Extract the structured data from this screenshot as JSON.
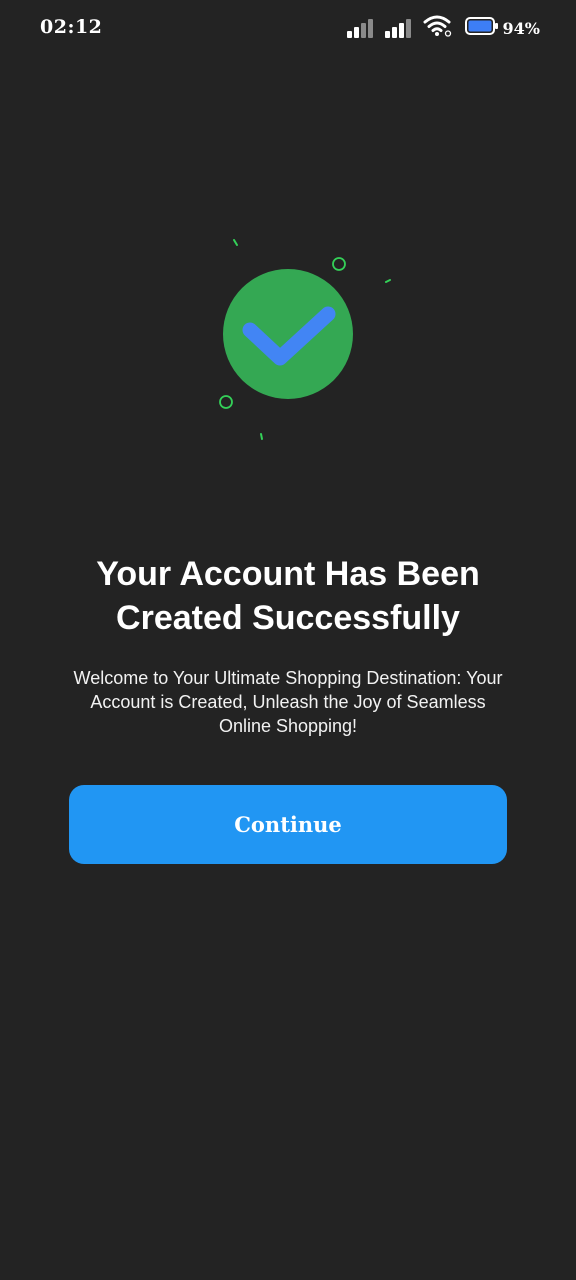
{
  "status_bar": {
    "time": "02:12",
    "battery_percent": "94%",
    "icons": [
      "signal-icon",
      "signal-icon",
      "wifi-icon",
      "battery-icon"
    ]
  },
  "illustration": {
    "icon": "check-circle-icon",
    "circle_color": "#34a853",
    "check_color": "#4285f4",
    "confetti_color": "#34d058"
  },
  "content": {
    "title": "Your Account Has Been Created Successfully",
    "description": "Welcome to Your Ultimate Shopping Destination: Your Account is Created, Unleash the Joy of Seamless Online Shopping!"
  },
  "actions": {
    "continue_label": "Continue",
    "continue_color": "#2196f3"
  },
  "theme": {
    "background": "#232323"
  }
}
